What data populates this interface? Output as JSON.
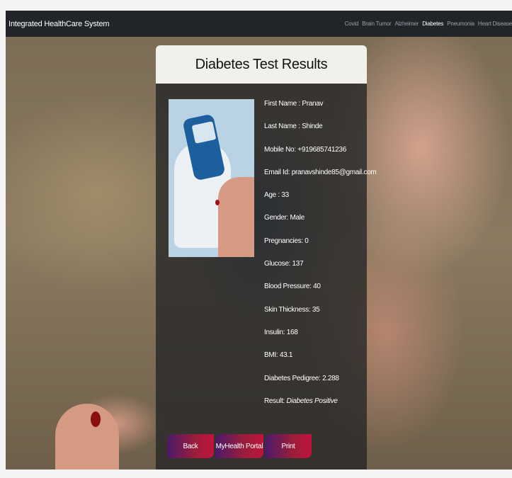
{
  "navbar": {
    "brand": "Integrated HealthCare System",
    "links": [
      {
        "label": "Covid"
      },
      {
        "label": "Brain Tumor"
      },
      {
        "label": "Alzheimer"
      },
      {
        "label": "Diabetes",
        "active": true
      },
      {
        "label": "Pneumonia"
      },
      {
        "label": "Heart Disease"
      }
    ]
  },
  "card": {
    "title": "Diabetes Test Results",
    "image_icon": "glucose-meter-photo",
    "fields": [
      {
        "label": "First Name : ",
        "value": "Pranav"
      },
      {
        "label": "Last Name : ",
        "value": "Shinde"
      },
      {
        "label": "Mobile No: ",
        "value": "+919685741236"
      },
      {
        "label": "Email Id: ",
        "value": "pranavshinde85@gmail.com"
      },
      {
        "label": "Age : ",
        "value": "33"
      },
      {
        "label": "Gender: ",
        "value": "Male"
      },
      {
        "label": "Pregnancies: ",
        "value": "0"
      },
      {
        "label": "Glucose: ",
        "value": "137"
      },
      {
        "label": "Blood Pressure: ",
        "value": "40"
      },
      {
        "label": "Skin Thickness: ",
        "value": "35"
      },
      {
        "label": "Insulin: ",
        "value": "168"
      },
      {
        "label": "BMI: ",
        "value": "43.1"
      },
      {
        "label": "Diabetes Pedigree: ",
        "value": "2.288"
      },
      {
        "label": "Result: ",
        "value": "Diabetes Positive"
      }
    ],
    "buttons": {
      "back": "Back",
      "portal": "MyHealth Portal",
      "print": "Print"
    }
  },
  "colors": {
    "navbar_bg": "#212529",
    "card_bg": "rgba(40,40,40,0.82)",
    "header_bg": "#f1f0ec",
    "button_gradient_start": "#4a1b6a",
    "button_gradient_end": "#c0143c"
  }
}
